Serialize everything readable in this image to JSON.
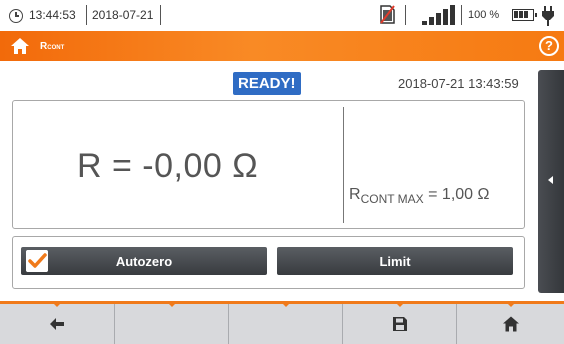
{
  "status_bar": {
    "time": "13:44:53",
    "date": "2018-07-21",
    "battery_percent": "100 %",
    "icons": [
      "clock-icon",
      "sd-card-missing-icon",
      "signal-strength-icon",
      "battery-icon",
      "power-plug-icon"
    ]
  },
  "title_bar": {
    "home_icon": "home-icon",
    "title_main": "R",
    "title_sub": "CONT",
    "help_label": "?"
  },
  "status": {
    "badge": "READY!",
    "badge_color": "#2f6cc4",
    "timestamp": "2018-07-21 13:43:59"
  },
  "result": {
    "main_value": "R = -0,00 Ω",
    "limit_prefix": "R",
    "limit_subscript": "CONT MAX",
    "limit_value": " = 1,00 Ω"
  },
  "controls": {
    "autozero_label": "Autozero",
    "autozero_checked": true,
    "limit_label": "Limit"
  },
  "bottom_bar": {
    "buttons": [
      "back-icon",
      "",
      "",
      "save-icon",
      "home-icon"
    ]
  },
  "colors": {
    "accent": "#f26a0a",
    "panel_dark": "#3c3f43",
    "bottom_bg": "#d8d9dc"
  }
}
